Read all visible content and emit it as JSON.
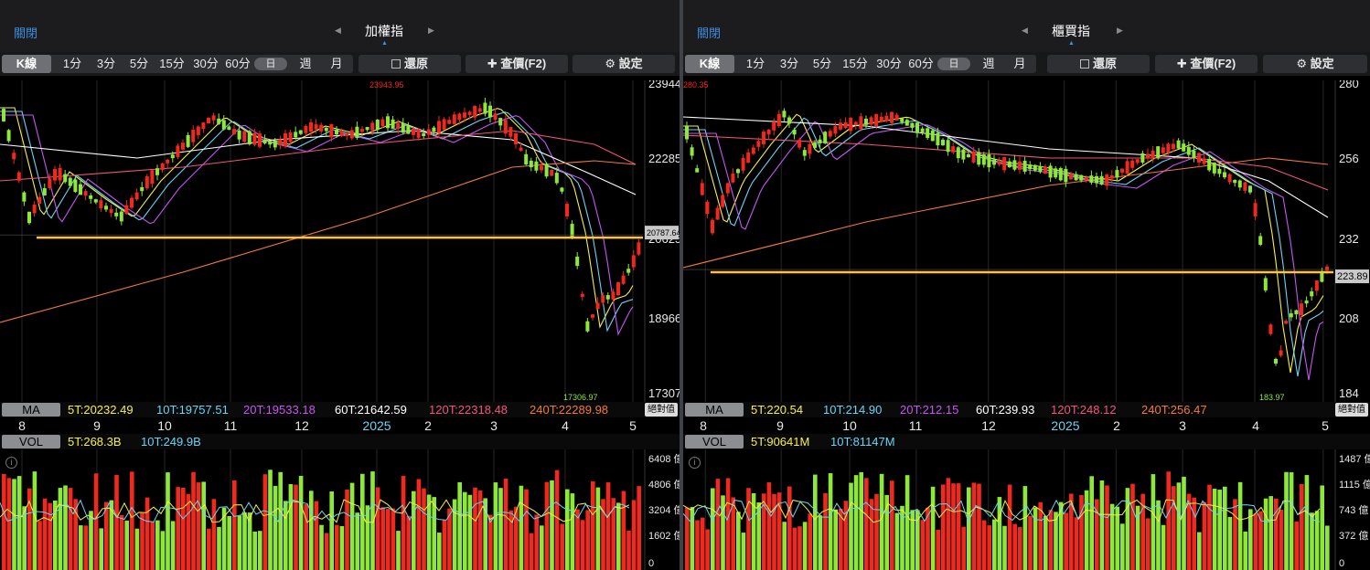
{
  "panes": [
    {
      "close_label": "關閉",
      "title": "加權指",
      "toolbar": {
        "kline": "K線",
        "intervals": [
          "1分",
          "3分",
          "5分",
          "15分",
          "30分",
          "60分"
        ],
        "day": "日",
        "week": "週",
        "month": "月",
        "restore": "還原",
        "lookup": "查價(F2)",
        "settings": "設定"
      },
      "price_labels": [
        "23944",
        "22285",
        "20625",
        "18966",
        "17307"
      ],
      "current_price": "20787.64",
      "high_label": "23943.95",
      "low_label": "17306.97",
      "ma": {
        "label": "MA",
        "items": [
          {
            "text": "5T:20232.49",
            "color": "#f6f046"
          },
          {
            "text": "10T:19757.51",
            "color": "#6ad4f5"
          },
          {
            "text": "20T:19533.18",
            "color": "#c356f0"
          },
          {
            "text": "60T:21642.59",
            "color": "#ffffff"
          },
          {
            "text": "120T:22318.48",
            "color": "#f0557a"
          },
          {
            "text": "240T:22289.98",
            "color": "#f07a3a"
          }
        ],
        "abs_label": "絕對值"
      },
      "x_labels": [
        "8",
        "9",
        "10",
        "11",
        "12",
        "2025",
        "2",
        "3",
        "4",
        "5"
      ],
      "vol": {
        "label": "VOL",
        "items": [
          {
            "text": "5T:268.3B",
            "color": "#f6f046"
          },
          {
            "text": "10T:249.9B",
            "color": "#6ad4f5"
          }
        ],
        "axis": [
          "6408 億",
          "4806 億",
          "3204 億",
          "1602 億",
          "0"
        ]
      },
      "chart_data": {
        "type": "candlestick",
        "y_range": [
          17307,
          23944
        ],
        "support_line": 20700,
        "series": "日K 加權指"
      }
    },
    {
      "close_label": "關閉",
      "title": "櫃買指",
      "toolbar": {
        "kline": "K線",
        "intervals": [
          "1分",
          "3分",
          "5分",
          "15分",
          "30分",
          "60分"
        ],
        "day": "日",
        "week": "週",
        "month": "月",
        "restore": "還原",
        "lookup": "查價(F2)",
        "settings": "設定"
      },
      "price_labels": [
        "280",
        "256",
        "232",
        "208",
        "184"
      ],
      "current_price": "223.89",
      "high_label": "280.35",
      "low_label": "183.97",
      "ma": {
        "label": "MA",
        "items": [
          {
            "text": "5T:220.54",
            "color": "#f6f046"
          },
          {
            "text": "10T:214.90",
            "color": "#6ad4f5"
          },
          {
            "text": "20T:212.15",
            "color": "#c356f0"
          },
          {
            "text": "60T:239.93",
            "color": "#ffffff"
          },
          {
            "text": "120T:248.12",
            "color": "#f0557a"
          },
          {
            "text": "240T:256.47",
            "color": "#f07a3a"
          }
        ],
        "abs_label": "絕對值"
      },
      "x_labels": [
        "8",
        "9",
        "10",
        "11",
        "12",
        "2025",
        "2",
        "3",
        "4",
        "5"
      ],
      "vol": {
        "label": "VOL",
        "items": [
          {
            "text": "5T:90641M",
            "color": "#f6f046"
          },
          {
            "text": "10T:81147M",
            "color": "#6ad4f5"
          }
        ],
        "axis": [
          "1487 億",
          "1115 億",
          "743 億",
          "372 億",
          "0"
        ]
      },
      "chart_data": {
        "type": "candlestick",
        "y_range": [
          184,
          280
        ],
        "support_line": 222.5,
        "series": "日K 櫃買指"
      }
    }
  ],
  "colors": {
    "up": "#f0281e",
    "down": "#8ee83a",
    "support": "#ffc23a",
    "accent": "#3f8ee0"
  }
}
